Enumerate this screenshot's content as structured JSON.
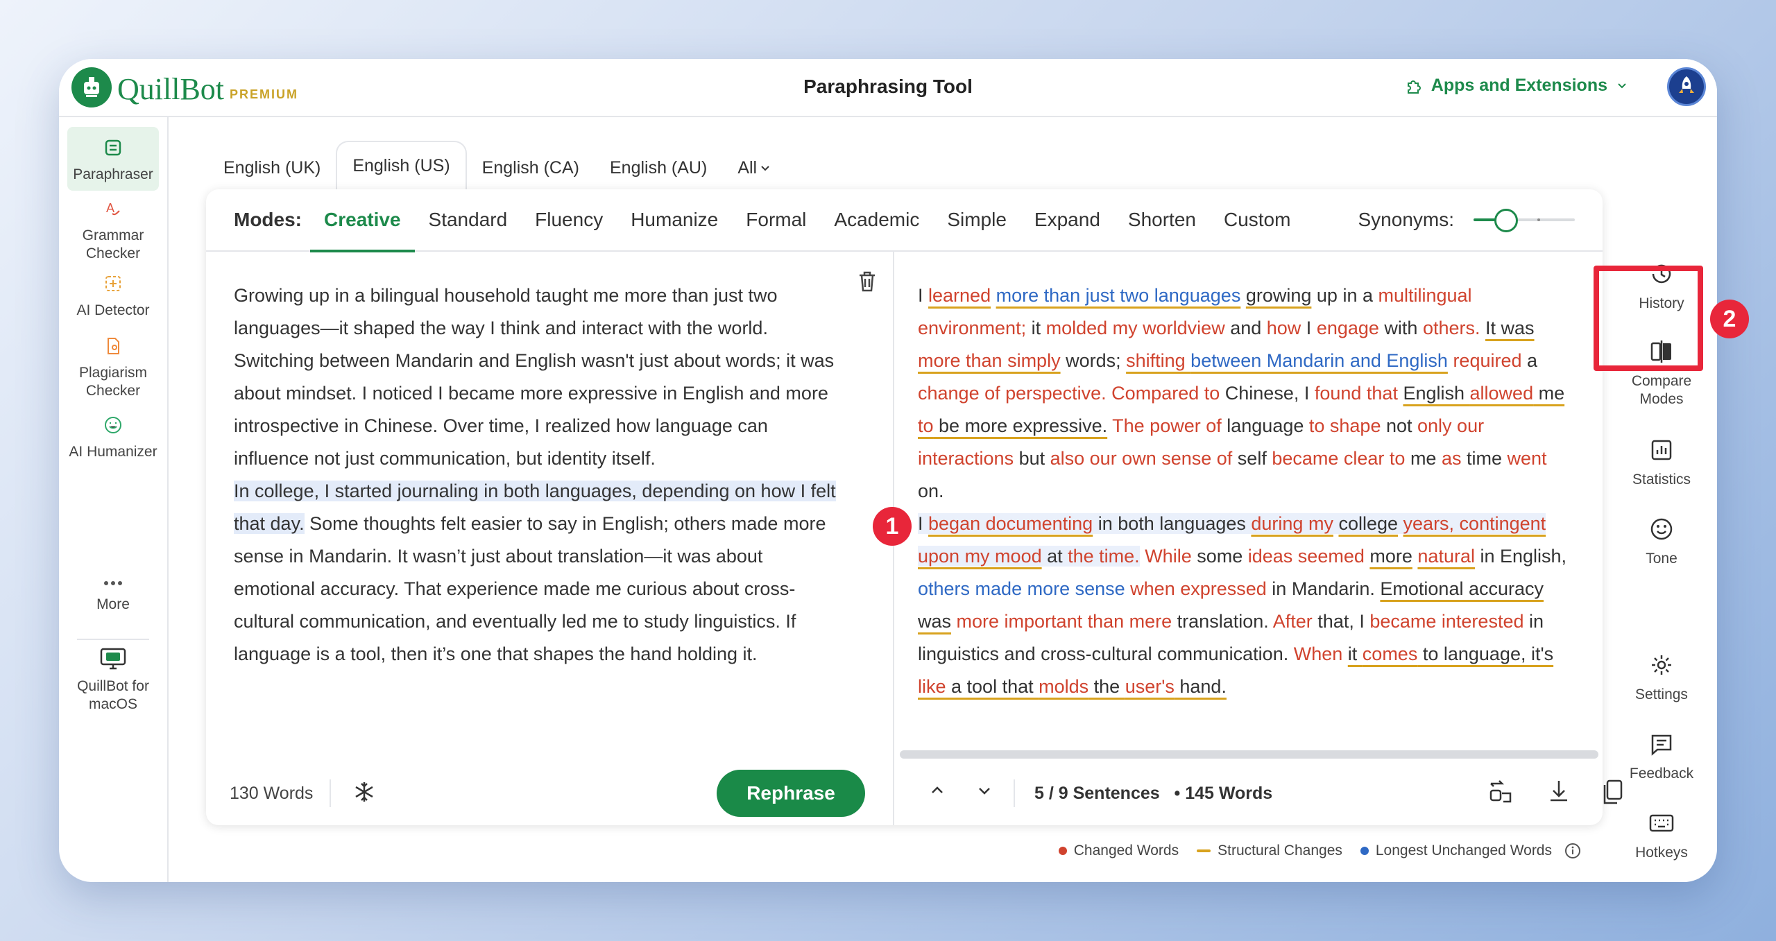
{
  "app": {
    "brand": "QuillBot",
    "tier": "PREMIUM",
    "title": "Paraphrasing Tool",
    "apps_label": "Apps and Extensions"
  },
  "left_nav": [
    {
      "label": "Paraphraser",
      "icon": "paraphraser-icon",
      "active": true
    },
    {
      "label": "Grammar Checker",
      "icon": "grammar-icon"
    },
    {
      "label": "AI Detector",
      "icon": "ai-detector-icon"
    },
    {
      "label": "Plagiarism Checker",
      "icon": "plagiarism-icon"
    },
    {
      "label": "AI Humanizer",
      "icon": "humanizer-icon"
    },
    {
      "label": "More",
      "icon": "more-dots-icon"
    },
    {
      "label": "QuillBot for macOS",
      "icon": "desktop-app-icon"
    }
  ],
  "language_tabs": [
    "English (UK)",
    "English (US)",
    "English (CA)",
    "English (AU)",
    "All"
  ],
  "active_language": "English (US)",
  "modes": {
    "label": "Modes:",
    "items": [
      "Creative",
      "Standard",
      "Fluency",
      "Humanize",
      "Formal",
      "Academic",
      "Simple",
      "Expand",
      "Shorten",
      "Custom"
    ],
    "active": "Creative",
    "synonyms_label": "Synonyms:",
    "synonyms_level": 0.2
  },
  "input": {
    "para1": "Growing up in a bilingual household taught me more than just two languages—it shaped the way I think and interact with the world. Switching between Mandarin and English wasn't just about words; it was about mindset. I noticed I became more expressive in English and more introspective in Chinese. Over time, I realized how language can influence not just communication, but identity itself.",
    "para2_highlight": "In college, I started journaling in both languages, depending on how I felt that day.",
    "para2_rest": " Some thoughts felt easier to say in English; others made more sense in Mandarin. It wasn’t just about translation—it was about emotional accuracy. That experience made me curious about cross-cultural communication, and eventually led me to study linguistics. If language is a tool, then it’s one that shapes the hand holding it.",
    "word_count": "130 Words",
    "rephrase_label": "Rephrase"
  },
  "output": {
    "sentence_status": "5 / 9 Sentences",
    "word_count": "• 145 Words"
  },
  "right_nav": [
    {
      "label": "History",
      "icon": "history-icon"
    },
    {
      "label": "Compare Modes",
      "icon": "compare-modes-icon"
    },
    {
      "label": "Statistics",
      "icon": "statistics-icon"
    },
    {
      "label": "Tone",
      "icon": "tone-icon"
    },
    {
      "label": "Settings",
      "icon": "settings-icon"
    },
    {
      "label": "Feedback",
      "icon": "feedback-icon"
    },
    {
      "label": "Hotkeys",
      "icon": "hotkeys-icon"
    }
  ],
  "callouts": [
    "1",
    "2"
  ],
  "legend": {
    "changed": "Changed Words",
    "structural": "Structural Changes",
    "unchanged": "Longest Unchanged Words"
  },
  "colors": {
    "brand_green": "#1d8a4b",
    "changed_red": "#d0432e",
    "structural_gold": "#d8a21e",
    "unchanged_blue": "#2f69c4",
    "callout_red": "#e8263a"
  }
}
